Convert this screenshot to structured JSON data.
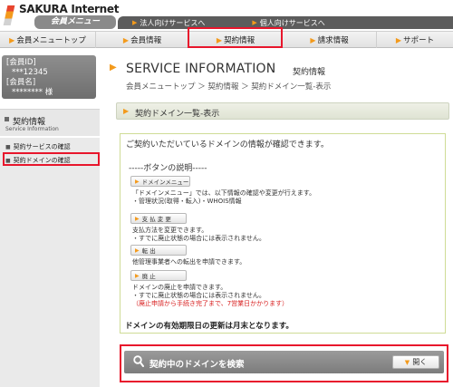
{
  "brand": {
    "name": "SAKURA Internet",
    "subtitle": "会員メニュー"
  },
  "topbar": {
    "links": [
      "法人向けサービスへ",
      "個人向けサービスへ"
    ]
  },
  "mainnav": {
    "items": [
      "会員メニュートップ",
      "会員情報",
      "契約情報",
      "請求情報",
      "サポート"
    ],
    "active": "契約情報"
  },
  "member": {
    "id_label": "[会員ID]",
    "id_value": "***12345",
    "name_label": "[会員名]",
    "name_value": "******** 様"
  },
  "sidebar": {
    "section_title": "契約情報",
    "section_sub": "Service Information",
    "links": [
      "契約サービスの確認",
      "契約ドメインの確認"
    ],
    "active": "契約ドメインの確認"
  },
  "page": {
    "title": "SERVICE INFORMATION",
    "title_ja": "契約情報",
    "breadcrumb": "会員メニュートップ ＞ 契約情報 ＞ 契約ドメイン一覧-表示",
    "section_title": "契約ドメイン一覧-表示",
    "intro": "ご契約いただいているドメインの情報が確認できます。",
    "button_desc_title": "-----ボタンの説明-----"
  },
  "buttons": [
    {
      "label": "ドメインメニュー",
      "desc": [
        "「ドメインメニュー」では、以下情報の確認や変更が行えます。",
        "・管理状況(取得・転入)・WHOIS情報"
      ]
    },
    {
      "label": "支 払 変 更",
      "desc": [
        "支払方法を変更できます。",
        "・すでに廃止状態の場合には表示されません。"
      ]
    },
    {
      "label": "転 出",
      "desc": [
        "他管理事業者への転出を申請できます。"
      ]
    },
    {
      "label": "廃 止",
      "desc": [
        "ドメインの廃止を申請できます。",
        "・すでに廃止状態の場合には表示されません。"
      ],
      "note": "（廃止申請から手続き完了まで、7営業日かかります）"
    }
  ],
  "notice": "ドメインの有効期限日の更新は月末となります。",
  "search": {
    "label": "契約中のドメインを検索",
    "open_label": "開く"
  },
  "colors": {
    "accent": "#f39a1c",
    "highlight": "#e8162c",
    "note_red": "#d82020"
  }
}
